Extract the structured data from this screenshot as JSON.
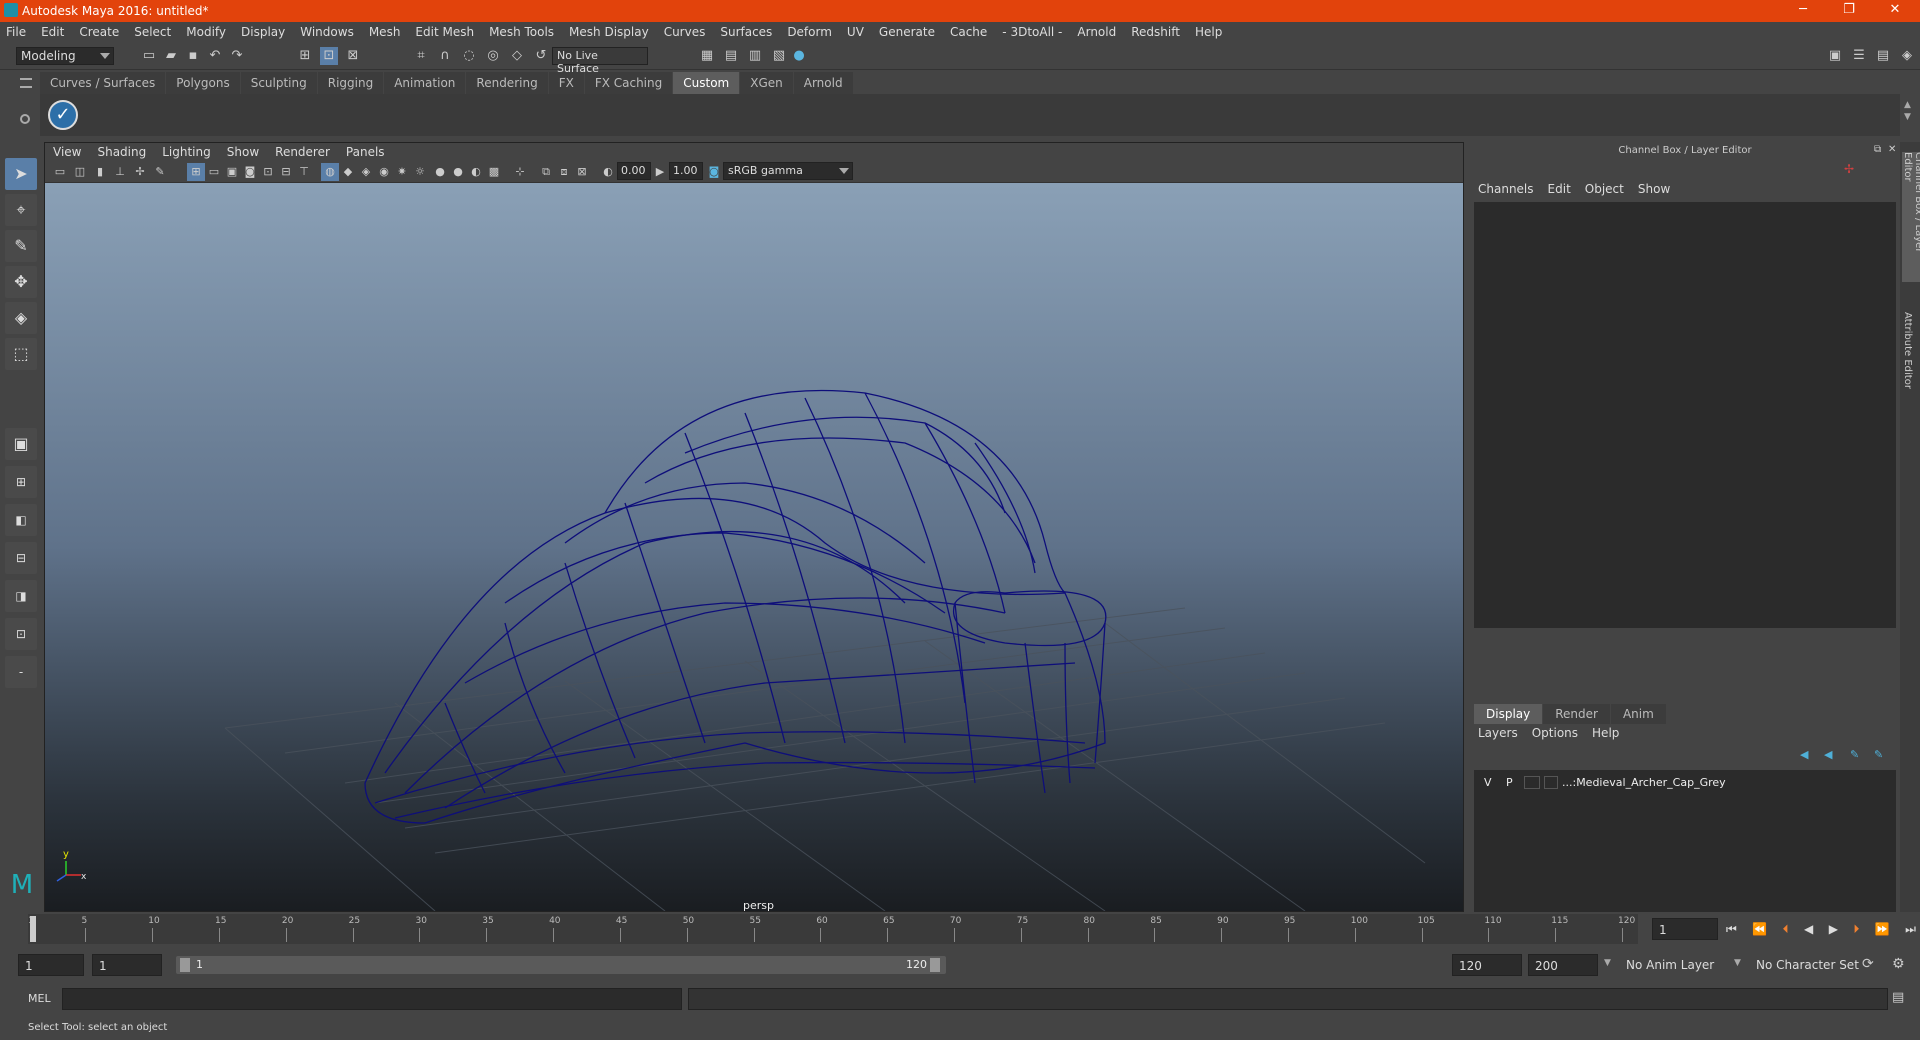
{
  "window": {
    "title": "Autodesk Maya 2016: untitled*",
    "minimize": "─",
    "maximize": "❐",
    "close": "✕"
  },
  "menubar": [
    "File",
    "Edit",
    "Create",
    "Select",
    "Modify",
    "Display",
    "Windows",
    "Mesh",
    "Edit Mesh",
    "Mesh Tools",
    "Mesh Display",
    "Curves",
    "Surfaces",
    "Deform",
    "UV",
    "Generate",
    "Cache",
    "- 3DtoAll -",
    "Arnold",
    "Redshift",
    "Help"
  ],
  "status": {
    "mode": "Modeling",
    "live_surface": "No Live Surface"
  },
  "shelf_tabs": [
    "Curves / Surfaces",
    "Polygons",
    "Sculpting",
    "Rigging",
    "Animation",
    "Rendering",
    "FX",
    "FX Caching",
    "Custom",
    "XGen",
    "Arnold"
  ],
  "shelf_active": "Custom",
  "panel_menu": [
    "View",
    "Shading",
    "Lighting",
    "Show",
    "Renderer",
    "Panels"
  ],
  "panel_tools": {
    "exposure": "0.00",
    "gamma": "1.00",
    "colorspace": "sRGB gamma"
  },
  "viewport": {
    "camera": "persp",
    "axis_y": "y",
    "axis_x": "x"
  },
  "channel_box": {
    "header": "Channel Box / Layer Editor",
    "tabs": [
      "Channels",
      "Edit",
      "Object",
      "Show"
    ],
    "layer_tabs": [
      "Display",
      "Render",
      "Anim"
    ],
    "layer_active": "Display",
    "layer_menu": [
      "Layers",
      "Options",
      "Help"
    ],
    "layers": [
      {
        "v": "V",
        "p": "P",
        "name": "...:Medieval_Archer_Cap_Grey"
      }
    ]
  },
  "side_tabs": [
    "Channel Box / Layer Editor",
    "Attribute Editor"
  ],
  "timeline": {
    "ticks": [
      "1",
      "5",
      "10",
      "15",
      "20",
      "25",
      "30",
      "35",
      "40",
      "45",
      "50",
      "55",
      "60",
      "65",
      "70",
      "75",
      "80",
      "85",
      "90",
      "95",
      "100",
      "105",
      "110",
      "115",
      "120"
    ],
    "current_frame": "1"
  },
  "range": {
    "start": "1",
    "inner_start": "1",
    "slider_start": "1",
    "slider_end": "120",
    "end": "120",
    "max": "200",
    "anim_layer": "No Anim Layer",
    "char_set": "No Character Set"
  },
  "command": {
    "label": "MEL"
  },
  "help": {
    "text": "Select Tool: select an object"
  }
}
